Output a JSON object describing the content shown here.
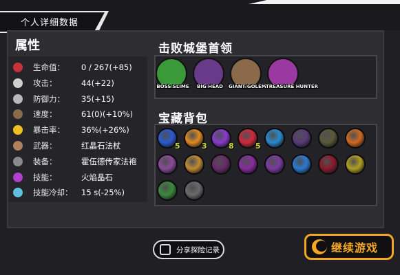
{
  "window": {
    "title": "个人详细数据"
  },
  "attributes": {
    "header": "属性",
    "rows": [
      {
        "icon": "heart-icon",
        "label": "生命值：",
        "value": "0 / 267(+85)",
        "color": "#c8323a"
      },
      {
        "icon": "sword-icon",
        "label": "攻击：",
        "value": "44(+22)",
        "color": "#cfcfcf"
      },
      {
        "icon": "shield-icon",
        "label": "防御力：",
        "value": "35(+15)",
        "color": "#b8b8b8"
      },
      {
        "icon": "boot-icon",
        "label": "速度：",
        "value": "61(0)(+10%)",
        "color": "#8a6a4a"
      },
      {
        "icon": "crit-star-icon",
        "label": "暴击率：",
        "value": "36%(+26%)",
        "color": "#f0c020"
      },
      {
        "icon": "staff-icon",
        "label": "武器：",
        "value": "红晶石法杖",
        "color": "#b08060"
      },
      {
        "icon": "robe-icon",
        "label": "装备：",
        "value": "霍伍德传家法袍",
        "color": "#8a8a8a"
      },
      {
        "icon": "magic-icon",
        "label": "技能：",
        "value": "火焰晶石",
        "color": "#b040d0"
      },
      {
        "icon": "cooldown-icon",
        "label": "技能冷却：",
        "value": "15 s(-25%)",
        "color": "#60c0e0"
      }
    ]
  },
  "bosses": {
    "title": "击败城堡首领",
    "items": [
      {
        "name": "BOSS SLIME",
        "icon": "boss-slime-icon",
        "color": "#3a9a3a"
      },
      {
        "name": "BIG HEAD",
        "icon": "big-head-icon",
        "color": "#6a3a8a"
      },
      {
        "name": "GIANT GOLEM",
        "icon": "giant-golem-icon",
        "color": "#8a6a4a"
      },
      {
        "name": "TREASURE HUNTER",
        "icon": "treasure-hunter-icon",
        "color": "#9a3aa0"
      }
    ]
  },
  "treasure": {
    "title": "宝藏背包",
    "items": [
      {
        "icon": "blue-gem-icon",
        "color": "#2a5ad0",
        "count": "5"
      },
      {
        "icon": "fire-gem-icon",
        "color": "#e08a20",
        "count": "3"
      },
      {
        "icon": "purple-crystal-icon",
        "color": "#8a3ad0",
        "count": "8"
      },
      {
        "icon": "red-gem-icon",
        "color": "#d02a3a",
        "count": "5"
      },
      {
        "icon": "ice-crystal-icon",
        "color": "#2a8ad0",
        "count": ""
      },
      {
        "icon": "purple-beast-icon",
        "color": "#5a3a7a",
        "count": ""
      },
      {
        "icon": "rope-icon",
        "color": "#5a5a3a",
        "count": ""
      },
      {
        "icon": "fire-claw-icon",
        "color": "#d06a20",
        "count": ""
      },
      {
        "icon": "purple-scroll-icon",
        "color": "#8a4a9a",
        "count": ""
      },
      {
        "icon": "golden-rune-icon",
        "color": "#c08a30",
        "count": ""
      },
      {
        "icon": "triangle-rune-icon",
        "color": "#6a2a6a",
        "count": ""
      },
      {
        "icon": "purple-gem-icon",
        "color": "#8a2aa0",
        "count": ""
      },
      {
        "icon": "tentacle-icon",
        "color": "#7a3aa0",
        "count": ""
      },
      {
        "icon": "snowflake-icon",
        "color": "#2a7ad0",
        "count": ""
      },
      {
        "icon": "red-fang-icon",
        "color": "#8a1a2a",
        "count": ""
      },
      {
        "icon": "gold-ring-icon",
        "color": "#b0a020",
        "count": ""
      },
      {
        "icon": "green-potion-icon",
        "color": "#3a8a3a",
        "count": ""
      },
      {
        "icon": "iron-mask-icon",
        "color": "#6a6a6a",
        "count": ""
      }
    ]
  },
  "buttons": {
    "share": "分享探险记录",
    "continue": "继续游戏"
  },
  "colors": {
    "accent": "#f5a623",
    "count_text": "#c9d63a"
  }
}
